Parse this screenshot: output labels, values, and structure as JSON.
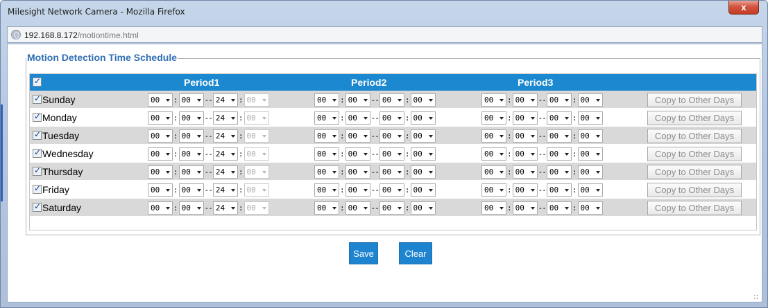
{
  "window": {
    "title": "Milesight Network Camera - Mozilla Firefox",
    "close_glyph": "x"
  },
  "address": {
    "host": "192.168.8.172",
    "path": "/motiontime.html"
  },
  "schedule": {
    "legend": "Motion Detection Time Schedule",
    "header": {
      "select_all_checked": true,
      "periods": [
        "Period1",
        "Period2",
        "Period3"
      ]
    },
    "copy_label": "Copy to Other Days",
    "days": [
      {
        "name": "Sunday",
        "checked": true
      },
      {
        "name": "Monday",
        "checked": true
      },
      {
        "name": "Tuesday",
        "checked": true
      },
      {
        "name": "Wednesday",
        "checked": true
      },
      {
        "name": "Thursday",
        "checked": true
      },
      {
        "name": "Friday",
        "checked": true
      },
      {
        "name": "Saturday",
        "checked": true
      }
    ],
    "period_values": [
      {
        "start_h": "00",
        "start_m": "00",
        "end_h": "24",
        "end_m": "00",
        "end_m_disabled": true
      },
      {
        "start_h": "00",
        "start_m": "00",
        "end_h": "00",
        "end_m": "00",
        "end_m_disabled": false
      },
      {
        "start_h": "00",
        "start_m": "00",
        "end_h": "00",
        "end_m": "00",
        "end_m_disabled": false
      }
    ],
    "time_sep": ":",
    "range_sep": "--"
  },
  "buttons": {
    "save": "Save",
    "clear": "Clear"
  },
  "colors": {
    "header_bg": "#1b88cf",
    "legend_text": "#2f6eb4",
    "button_bg": "#1f84cf",
    "row_alt": "#d9d9d9"
  }
}
